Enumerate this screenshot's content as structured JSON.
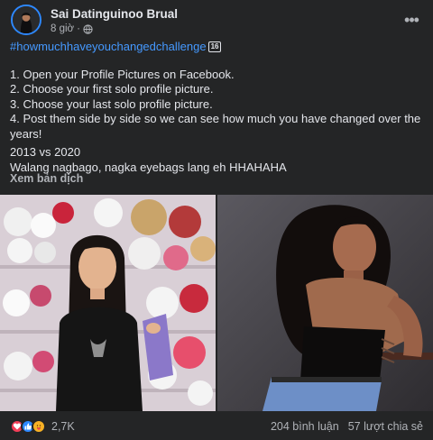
{
  "post": {
    "author": "Sai Datinguinoo Brual",
    "time": "8 giờ",
    "visibility_sep": "·",
    "hashtag": "#howmuchhaveyouchangedchallenge",
    "hashtag_badge": "16",
    "lines": [
      "1. Open your Profile Pictures on Facebook.",
      "2. Choose your first solo profile picture.",
      "3. Choose your last solo profile picture.",
      "4. Post them side by side so we can see how much you have changed over the years!"
    ],
    "caption_line1": "2013 vs 2020",
    "caption_line2": "Walang nagbago, nagka eyebags lang eh HHAHAHA",
    "translate": "Xem bản dịch"
  },
  "footer": {
    "reaction_count": "2,7K",
    "comments": "204 bình luận",
    "shares": "57 lượt chia sẻ"
  },
  "icons": {
    "more": "more-options-icon",
    "globe": "globe-icon",
    "reactions": [
      "love-icon",
      "like-icon",
      "care-icon"
    ]
  },
  "colors": {
    "background": "#242526",
    "hashtag": "#4599ff",
    "like": "#2d88ff",
    "love": "#f33e58",
    "care": "#f7b125"
  }
}
